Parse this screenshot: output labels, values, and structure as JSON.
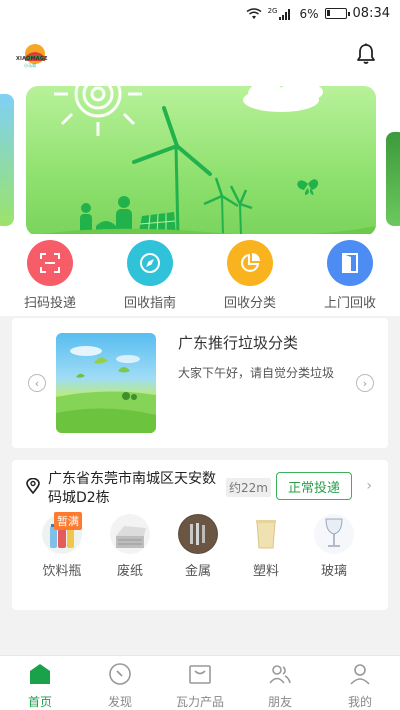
{
  "status_bar": {
    "network": "2G",
    "battery": "6%",
    "time": "08:34"
  },
  "header": {
    "logo_text": "XIAOMAGE",
    "logo_sub": "小马哥"
  },
  "quick_nav": [
    {
      "label": "扫码投递",
      "color": "#f75c69",
      "icon": "scan-icon"
    },
    {
      "label": "回收指南",
      "color": "#2fc2d8",
      "icon": "compass-icon"
    },
    {
      "label": "回收分类",
      "color": "#f9b31f",
      "icon": "pie-chart-icon"
    },
    {
      "label": "上门回收",
      "color": "#4d8cf2",
      "icon": "door-icon"
    }
  ],
  "promo": {
    "title": "广东推行垃圾分类",
    "description": "大家下午好，请自觉分类垃圾"
  },
  "location": {
    "address": "广东省东莞市南城区天安数码城D2栋",
    "distance": "约22m",
    "status_button": "正常投递",
    "items": [
      {
        "label": "饮料瓶",
        "tag": "暂满",
        "icon": "bottle-icon"
      },
      {
        "label": "废纸",
        "icon": "paper-icon"
      },
      {
        "label": "金属",
        "icon": "metal-icon"
      },
      {
        "label": "塑料",
        "icon": "plastic-icon"
      },
      {
        "label": "玻璃",
        "icon": "glass-icon"
      }
    ]
  },
  "tabs": [
    {
      "label": "首页",
      "icon": "home-icon",
      "active": true
    },
    {
      "label": "发现",
      "icon": "discover-icon",
      "active": false
    },
    {
      "label": "瓦力产品",
      "icon": "product-icon",
      "active": false
    },
    {
      "label": "朋友",
      "icon": "friends-icon",
      "active": false
    },
    {
      "label": "我的",
      "icon": "profile-icon",
      "active": false
    }
  ],
  "colors": {
    "accent": "#1aa24a",
    "tag": "#ff7a2e"
  }
}
